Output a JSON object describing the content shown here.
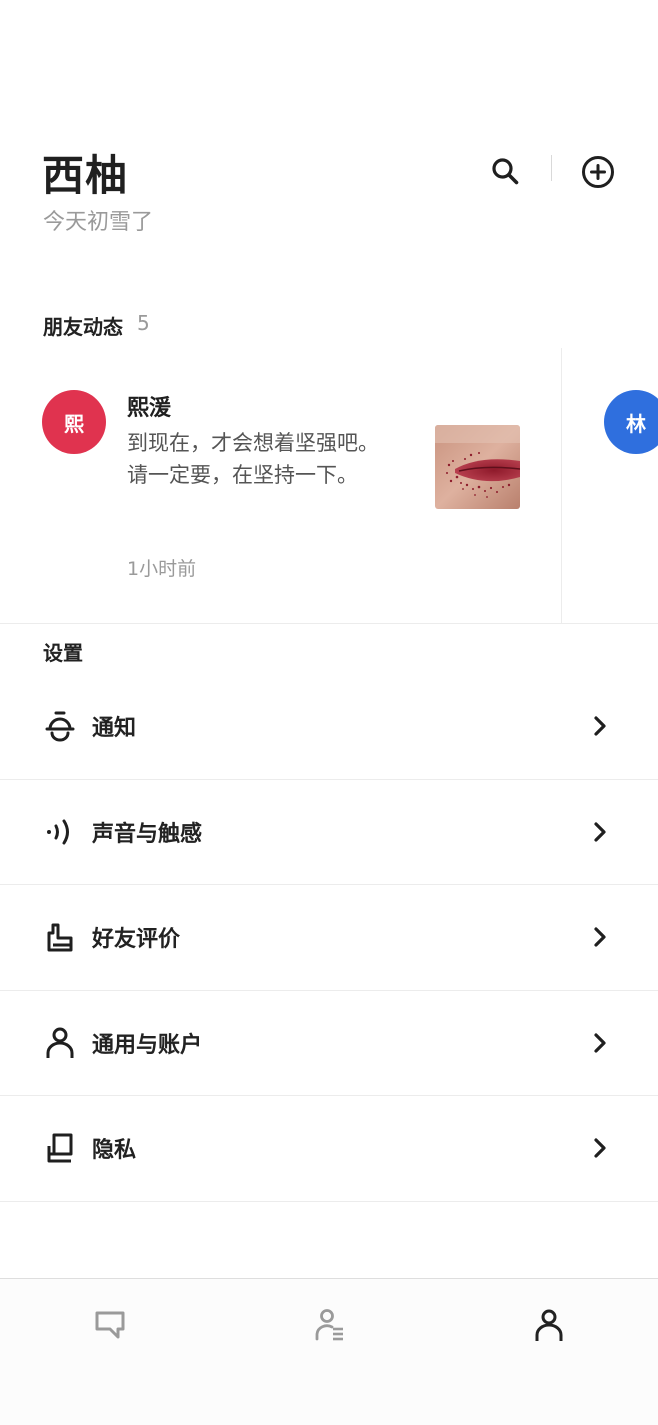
{
  "header": {
    "title": "西柚",
    "subtitle": "今天初雪了",
    "search_icon": "search-icon",
    "add_icon": "add-circle-icon"
  },
  "friends": {
    "label": "朋友动态",
    "count": "5",
    "posts": [
      {
        "avatar_text": "熙",
        "avatar_color": "#e0334f",
        "name": "熙湲",
        "text_line1": "到现在，才会想着坚强吧。",
        "text_line2": "请一定要，在坚持一下。",
        "time": "1小时前"
      },
      {
        "avatar_text": "林",
        "avatar_color": "#2f6fde"
      }
    ]
  },
  "settings": {
    "label": "设置",
    "items": [
      {
        "label": "通知",
        "icon": "bell-icon"
      },
      {
        "label": "声音与触感",
        "icon": "sound-wave-icon"
      },
      {
        "label": "好友评价",
        "icon": "thumbs-up-icon"
      },
      {
        "label": "通用与账户",
        "icon": "person-icon"
      },
      {
        "label": "隐私",
        "icon": "privacy-icon"
      }
    ]
  },
  "tabbar": {
    "tabs": [
      {
        "icon": "chat-icon",
        "active": false
      },
      {
        "icon": "contacts-icon",
        "active": false
      },
      {
        "icon": "profile-icon",
        "active": true
      }
    ],
    "active_color": "#222222",
    "inactive_color": "#9a9a9a"
  }
}
